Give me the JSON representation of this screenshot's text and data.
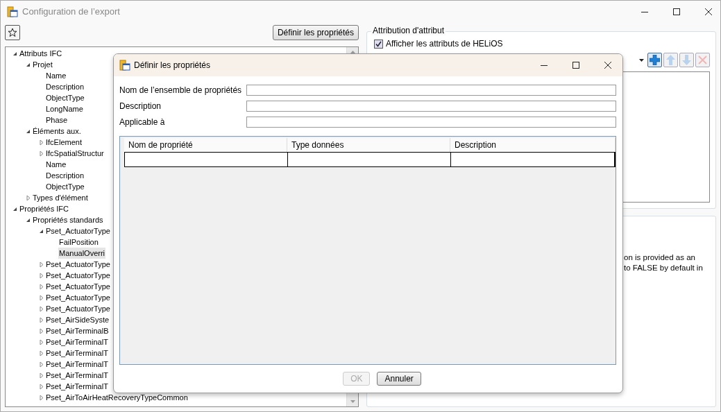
{
  "window": {
    "title": "Configuration de l’export"
  },
  "toolbar": {
    "define_button": "Définir les propriétés"
  },
  "tree": [
    {
      "label": "Attributs IFC",
      "expanded": true,
      "selected": false,
      "children": [
        {
          "label": "Projet",
          "expanded": true,
          "selected": false,
          "children": [
            {
              "label": "Name",
              "selected": false
            },
            {
              "label": "Description",
              "selected": false
            },
            {
              "label": "ObjectType",
              "selected": false
            },
            {
              "label": "LongName",
              "selected": false
            },
            {
              "label": "Phase",
              "selected": false
            }
          ]
        },
        {
          "label": "Éléments aux.",
          "expanded": true,
          "selected": false,
          "children": [
            {
              "label": "IfcElement",
              "expanded": false,
              "selected": false
            },
            {
              "label": "IfcSpatialStructur",
              "expanded": false,
              "selected": false
            },
            {
              "label": "Name",
              "selected": false
            },
            {
              "label": "Description",
              "selected": false
            },
            {
              "label": "ObjectType",
              "selected": false
            }
          ]
        },
        {
          "label": "Types d'élément",
          "expanded": false,
          "selected": false
        }
      ]
    },
    {
      "label": "Propriétés IFC",
      "expanded": true,
      "selected": false,
      "children": [
        {
          "label": "Propriétés standards",
          "expanded": true,
          "selected": false,
          "children": [
            {
              "label": "Pset_ActuatorType",
              "expanded": true,
              "selected": false,
              "children": [
                {
                  "label": "FailPosition",
                  "selected": false
                },
                {
                  "label": "ManualOverri",
                  "selected": true
                }
              ]
            },
            {
              "label": "Pset_ActuatorType",
              "expanded": false,
              "selected": false
            },
            {
              "label": "Pset_ActuatorType",
              "expanded": false,
              "selected": false
            },
            {
              "label": "Pset_ActuatorType",
              "expanded": false,
              "selected": false
            },
            {
              "label": "Pset_ActuatorType",
              "expanded": false,
              "selected": false
            },
            {
              "label": "Pset_ActuatorType",
              "expanded": false,
              "selected": false
            },
            {
              "label": "Pset_AirSideSyste",
              "expanded": false,
              "selected": false
            },
            {
              "label": "Pset_AirTerminalB",
              "expanded": false,
              "selected": false
            },
            {
              "label": "Pset_AirTerminalT",
              "expanded": false,
              "selected": false
            },
            {
              "label": "Pset_AirTerminalT",
              "expanded": false,
              "selected": false
            },
            {
              "label": "Pset_AirTerminalT",
              "expanded": false,
              "selected": false
            },
            {
              "label": "Pset_AirTerminalT",
              "expanded": false,
              "selected": false
            },
            {
              "label": "Pset_AirTerminalT",
              "expanded": false,
              "selected": false
            },
            {
              "label": "Pset_AirToAirHeatRecoveryTypeCommon",
              "expanded": false,
              "selected": false
            }
          ]
        }
      ]
    }
  ],
  "attribution": {
    "title": "Attribution d'attribut",
    "checkbox": {
      "label": "Afficher les attributs de HELiOS",
      "checked": true
    },
    "buttons": [
      {
        "kind": "add",
        "disabled": false
      },
      {
        "kind": "up",
        "disabled": true
      },
      {
        "kind": "down",
        "disabled": true
      },
      {
        "kind": "delete",
        "disabled": true
      }
    ]
  },
  "description_panel": {
    "lines": [
      "on is provided as an",
      "to FALSE by default in"
    ]
  },
  "dialog": {
    "title": "Définir les propriétés",
    "fields": [
      {
        "label": "Nom de l’ensemble de propriétés"
      },
      {
        "label": "Description"
      },
      {
        "label": "Applicable à"
      }
    ],
    "table": {
      "columns": [
        "Nom de propriété",
        "Type données",
        "Description"
      ]
    },
    "buttons": [
      {
        "label": "OK",
        "disabled": true
      },
      {
        "label": "Annuler",
        "disabled": false
      }
    ]
  }
}
